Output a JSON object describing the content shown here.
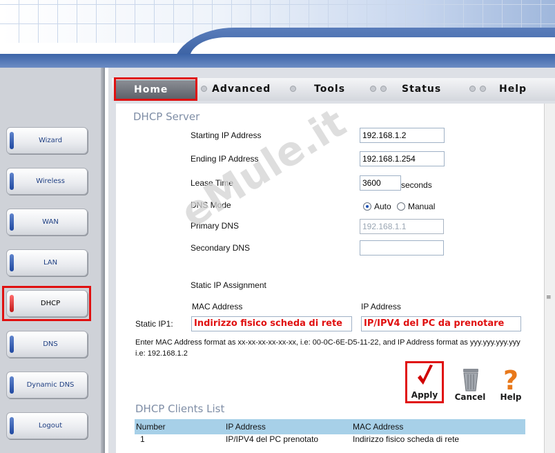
{
  "top_tabs": [
    "Home",
    "Advanced",
    "Tools",
    "Status",
    "Help"
  ],
  "sidebar": {
    "items": [
      {
        "label": "Wizard",
        "active": false
      },
      {
        "label": "Wireless",
        "active": false
      },
      {
        "label": "WAN",
        "active": false
      },
      {
        "label": "LAN",
        "active": false
      },
      {
        "label": "DHCP",
        "active": true
      },
      {
        "label": "DNS",
        "active": false
      },
      {
        "label": "Dynamic DNS",
        "active": false
      },
      {
        "label": "Logout",
        "active": false
      }
    ]
  },
  "dhcp_server": {
    "title": "DHCP Server",
    "starting_ip_label": "Starting IP Address",
    "starting_ip_value": "192.168.1.2",
    "ending_ip_label": "Ending IP Address",
    "ending_ip_value": "192.168.1.254",
    "lease_time_label": "Lease Time",
    "lease_time_value": "3600",
    "lease_time_unit": "seconds",
    "dns_mode_label": "DNS Mode",
    "dns_mode_auto": "Auto",
    "dns_mode_manual": "Manual",
    "dns_mode_selected": "Auto",
    "primary_dns_label": "Primary DNS",
    "primary_dns_value": "192.168.1.1",
    "secondary_dns_label": "Secondary DNS",
    "secondary_dns_value": ""
  },
  "static_ip": {
    "heading": "Static IP Assignment",
    "mac_col": "MAC Address",
    "ip_col": "IP Address",
    "row_label": "Static IP1:",
    "mac_value": "Indirizzo fisico scheda di rete",
    "ip_value": "IP/IPV4 del PC da prenotare",
    "note": "Enter MAC Address format as xx-xx-xx-xx-xx-xx, i.e: 00-0C-6E-D5-11-22, and IP Address format as yyy.yyy.yyy.yyy i.e: 192.168.1.2"
  },
  "actions": {
    "apply": "Apply",
    "cancel": "Cancel",
    "help": "Help"
  },
  "clients_list": {
    "title": "DHCP Clients List",
    "columns": [
      "Number",
      "IP Address",
      "MAC Address"
    ],
    "rows": [
      [
        "1",
        "IP/IPV4 del PC prenotato",
        "Indirizzo fisico scheda di rete"
      ]
    ]
  },
  "watermark": "eMule.it",
  "colors": {
    "highlight": "#e01010",
    "accent": "#1f48a0",
    "table_header": "#a7d0e8"
  }
}
